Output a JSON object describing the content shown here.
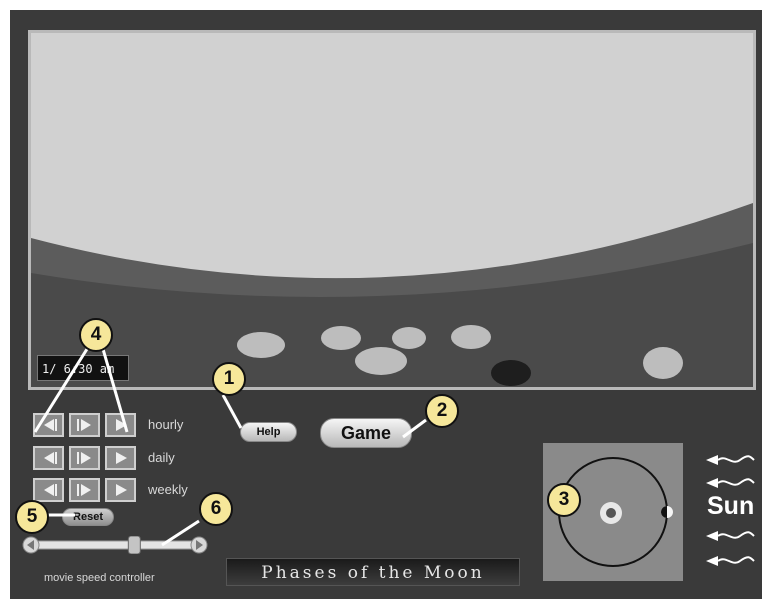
{
  "viewport": {
    "time_readout": "1/ 6:30 am"
  },
  "controls": {
    "rows": [
      {
        "label": "hourly"
      },
      {
        "label": "daily"
      },
      {
        "label": "weekly"
      }
    ],
    "reset_label": "Reset",
    "speed_label": "movie speed controller",
    "speed_value": 0.64
  },
  "buttons": {
    "help_label": "Help",
    "game_label": "Game"
  },
  "title_plate": "Phases of the Moon",
  "orbit": {
    "sun_label": "Sun"
  },
  "callouts": [
    "1",
    "2",
    "3",
    "4",
    "5",
    "6"
  ],
  "colors": {
    "background": "#3a3a3a",
    "sky": "#d0d0d0",
    "callout": "#f6e79a",
    "panel": "#8a8a8a"
  }
}
